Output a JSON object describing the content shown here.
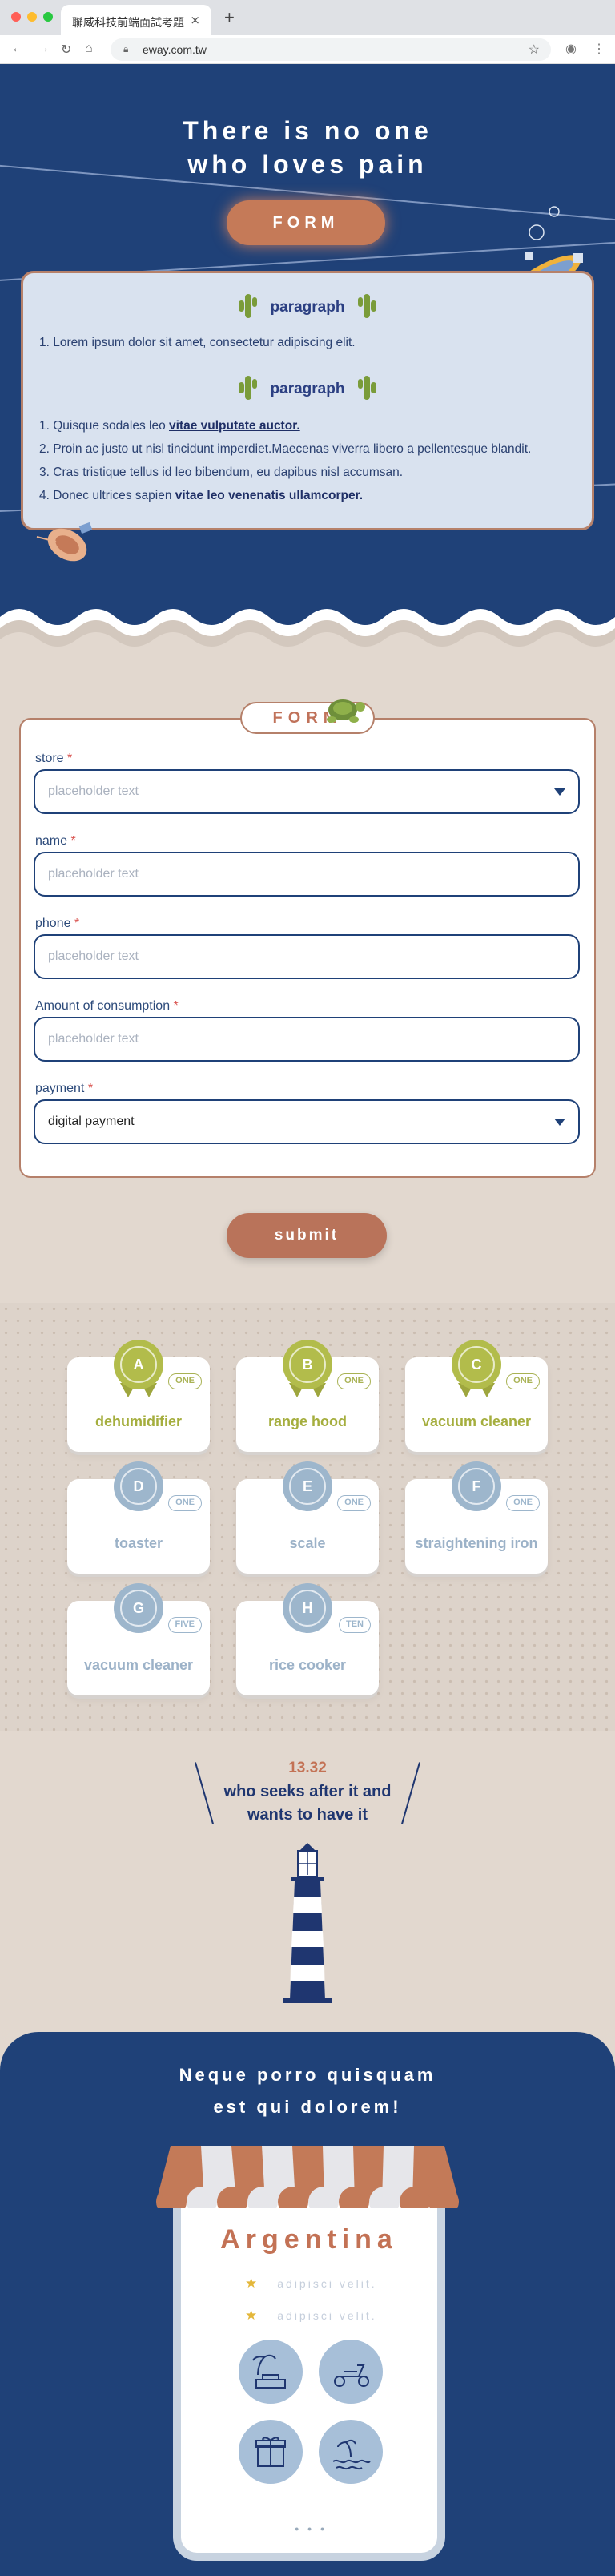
{
  "browser": {
    "tab_title": "聯威科技前端面試考題",
    "tab_close": "×",
    "new_tab": "+",
    "url": "eway.com.tw"
  },
  "hero": {
    "title_line1": "There is no one",
    "title_line2": "who loves pain",
    "form_button": "FORM",
    "panel": {
      "heading1": "paragraph",
      "list1": [
        {
          "num": "1.",
          "text": "Lorem ipsum dolor sit amet, consectetur adipiscing elit."
        }
      ],
      "heading2": "paragraph",
      "list2": [
        {
          "num": "1.",
          "pre": "Quisque sodales leo ",
          "link": "vitae vulputate auctor.",
          "post": ""
        },
        {
          "num": "2.",
          "pre": "Proin ac justo ut nisl tincidunt imperdiet.Maecenas viverra libero a pellentesque blandit.",
          "link": "",
          "post": ""
        },
        {
          "num": "3.",
          "pre": "Cras tristique tellus id leo bibendum, eu dapibus nisl accumsan.",
          "link": "",
          "post": ""
        },
        {
          "num": "4.",
          "pre": "Donec ultrices sapien ",
          "bold": "vitae leo venenatis ullamcorper.",
          "post": ""
        }
      ]
    }
  },
  "form": {
    "tag": "FORM",
    "required_mark": "*",
    "fields": [
      {
        "label": "store",
        "placeholder": "placeholder text",
        "type": "select",
        "value": ""
      },
      {
        "label": "name",
        "placeholder": "placeholder text",
        "type": "input",
        "value": ""
      },
      {
        "label": "phone",
        "placeholder": "placeholder text",
        "type": "input",
        "value": ""
      },
      {
        "label": "Amount of consumption",
        "placeholder": "placeholder text",
        "type": "input",
        "value": ""
      },
      {
        "label": "payment",
        "placeholder": "",
        "type": "select",
        "value": "digital payment"
      }
    ],
    "submit": "submit"
  },
  "prizes": [
    {
      "letter": "A",
      "name": "dehumidifier",
      "badge": "ONE",
      "style": "green"
    },
    {
      "letter": "B",
      "name": "range hood",
      "badge": "ONE",
      "style": "green"
    },
    {
      "letter": "C",
      "name": "vacuum cleaner",
      "badge": "ONE",
      "style": "green"
    },
    {
      "letter": "D",
      "name": "toaster",
      "badge": "ONE",
      "style": "blue"
    },
    {
      "letter": "E",
      "name": "scale",
      "badge": "ONE",
      "style": "blue"
    },
    {
      "letter": "F",
      "name": "straightening iron",
      "badge": "ONE",
      "style": "blue"
    },
    {
      "letter": "G",
      "name": "vacuum cleaner",
      "badge": "FIVE",
      "style": "blue"
    },
    {
      "letter": "H",
      "name": "rice cooker",
      "badge": "TEN",
      "style": "blue"
    }
  ],
  "quote": {
    "number": "13.32",
    "line1": "who seeks after it and",
    "line2": "wants to have it"
  },
  "bottom": {
    "title_line1": "Neque porro quisquam",
    "title_line2": "est qui dolorem!",
    "shop_name": "Argentina",
    "features": [
      "adipisci velit.",
      "adipisci velit."
    ],
    "icons": [
      "beach-house-icon",
      "scooter-icon",
      "gift-box-icon",
      "island-icon"
    ],
    "pager": "● ● ●"
  },
  "colors": {
    "navy": "#1f4178",
    "terracotta": "#c57a58",
    "sand": "#e2d8cf",
    "olive": "#b2bc4b",
    "pale_blue": "#9db6cc"
  }
}
